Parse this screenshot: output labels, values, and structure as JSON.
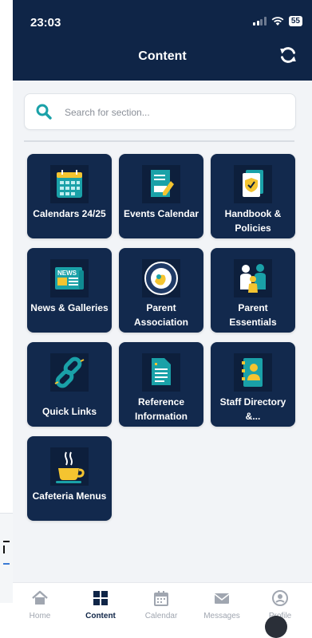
{
  "status": {
    "time": "23:03",
    "battery": "55"
  },
  "header": {
    "title": "Content"
  },
  "search": {
    "placeholder": "Search for section..."
  },
  "tiles": [
    {
      "label": "Calendars 24/25"
    },
    {
      "label": "Events Calendar"
    },
    {
      "label": "Handbook & Policies"
    },
    {
      "label": "News & Galleries"
    },
    {
      "label": "Parent Association"
    },
    {
      "label": "Parent Essentials"
    },
    {
      "label": "Quick Links"
    },
    {
      "label": "Reference Information"
    },
    {
      "label": "Staff Directory &..."
    },
    {
      "label": "Cafeteria Menus"
    }
  ],
  "tabs": [
    {
      "label": "Home"
    },
    {
      "label": "Content"
    },
    {
      "label": "Calendar"
    },
    {
      "label": "Messages"
    },
    {
      "label": "Profile"
    }
  ],
  "colors": {
    "header_bg": "#0f2547",
    "tile_bg": "#12294d",
    "accent_teal": "#1aa1a8",
    "icon_yellow": "#f4c430"
  },
  "icons": {
    "refresh": "refresh-icon",
    "search": "search-icon",
    "tabs": [
      "home-icon",
      "grid-icon",
      "calendar-icon",
      "mail-icon",
      "user-icon"
    ]
  }
}
